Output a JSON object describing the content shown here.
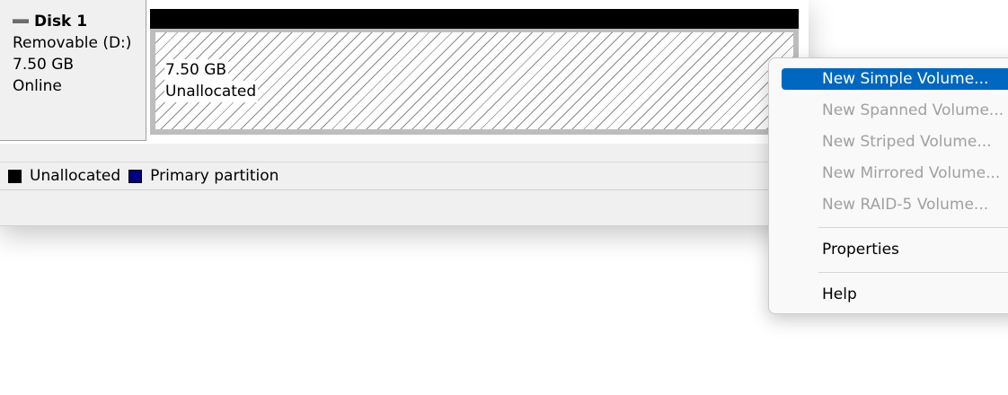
{
  "disk": {
    "name": "Disk 1",
    "type": "Removable (D:)",
    "size": "7.50 GB",
    "status": "Online"
  },
  "partition": {
    "size": "7.50 GB",
    "label": "Unallocated"
  },
  "legend": {
    "items": [
      {
        "label": "Unallocated",
        "color": "#000000"
      },
      {
        "label": "Primary partition",
        "color": "#000080"
      }
    ]
  },
  "context_menu": {
    "items": [
      {
        "label": "New Simple Volume...",
        "enabled": true,
        "highlighted": true
      },
      {
        "label": "New Spanned Volume...",
        "enabled": false
      },
      {
        "label": "New Striped Volume...",
        "enabled": false
      },
      {
        "label": "New Mirrored Volume...",
        "enabled": false
      },
      {
        "label": "New RAID-5 Volume...",
        "enabled": false
      },
      {
        "label": "Properties",
        "enabled": true
      },
      {
        "label": "Help",
        "enabled": true
      }
    ]
  },
  "colors": {
    "accent": "#0067c0",
    "unallocated_bar": "#000000",
    "primary_partition": "#000080",
    "disabled_text": "#a0a0a0"
  }
}
